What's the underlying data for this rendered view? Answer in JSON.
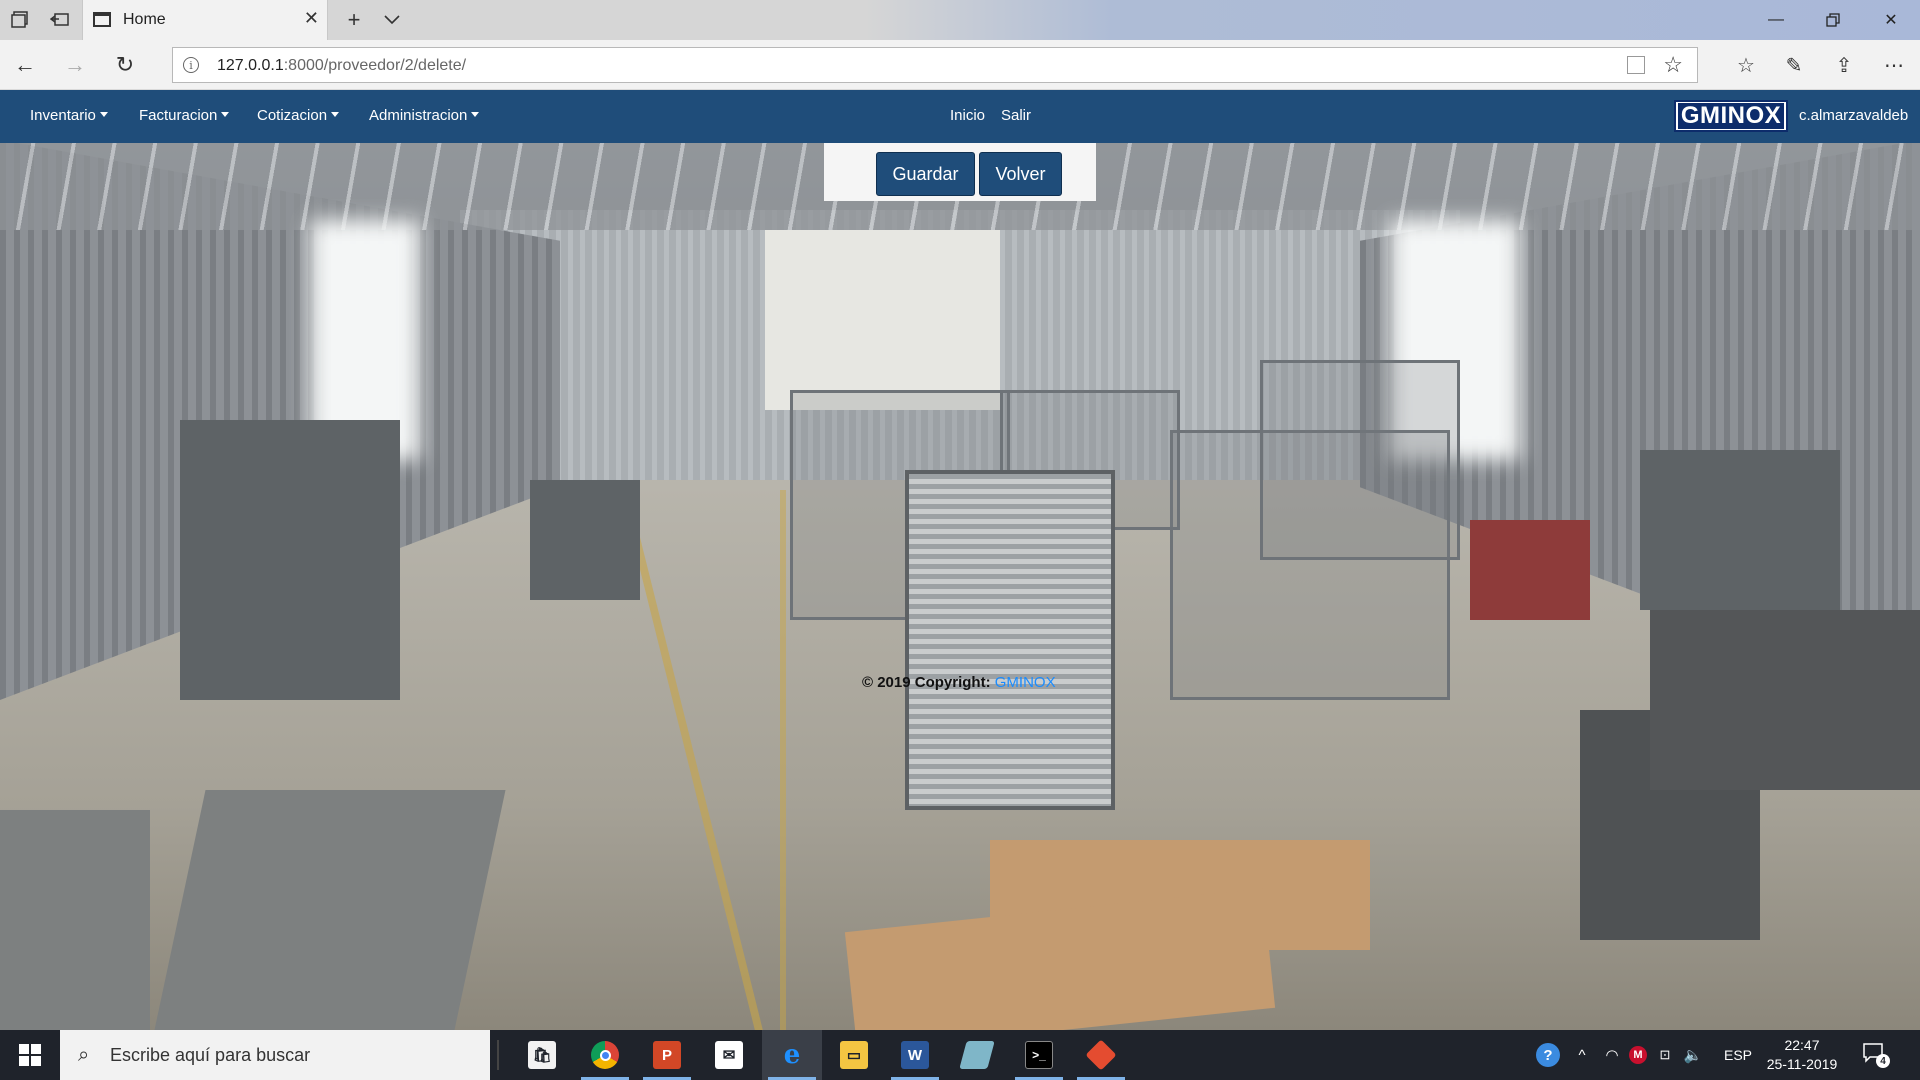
{
  "browser": {
    "tab_title": "Home",
    "url_host": "127.0.0.1",
    "url_rest": ":8000/proveedor/2/delete/"
  },
  "nav": {
    "menus": [
      {
        "label": "Inventario"
      },
      {
        "label": "Facturacion"
      },
      {
        "label": "Cotizacion"
      },
      {
        "label": "Administracion"
      }
    ],
    "links": [
      {
        "label": "Inicio"
      },
      {
        "label": "Salir"
      }
    ],
    "brand": "GMINOX",
    "username": "c.almarzavaldeb"
  },
  "form": {
    "save_label": "Guardar",
    "back_label": "Volver"
  },
  "footer": {
    "copyright": "© 2019 Copyright: ",
    "brand_link": "GMINOX"
  },
  "taskbar": {
    "search_placeholder": "Escribe aquí para buscar",
    "language": "ESP",
    "time": "22:47",
    "date": "25-11-2019",
    "notification_count": "4",
    "apps": [
      "store-icon",
      "chrome-icon",
      "powerpoint-icon",
      "mail-icon",
      "edge-icon",
      "file-explorer-icon",
      "word-icon",
      "3d-viewer-icon",
      "terminal-icon",
      "git-icon"
    ]
  },
  "colors": {
    "navbar": "#1f4d7a",
    "button": "#1f4d7a",
    "brand_link": "#1a8cff",
    "taskbar": "#1f232b"
  }
}
